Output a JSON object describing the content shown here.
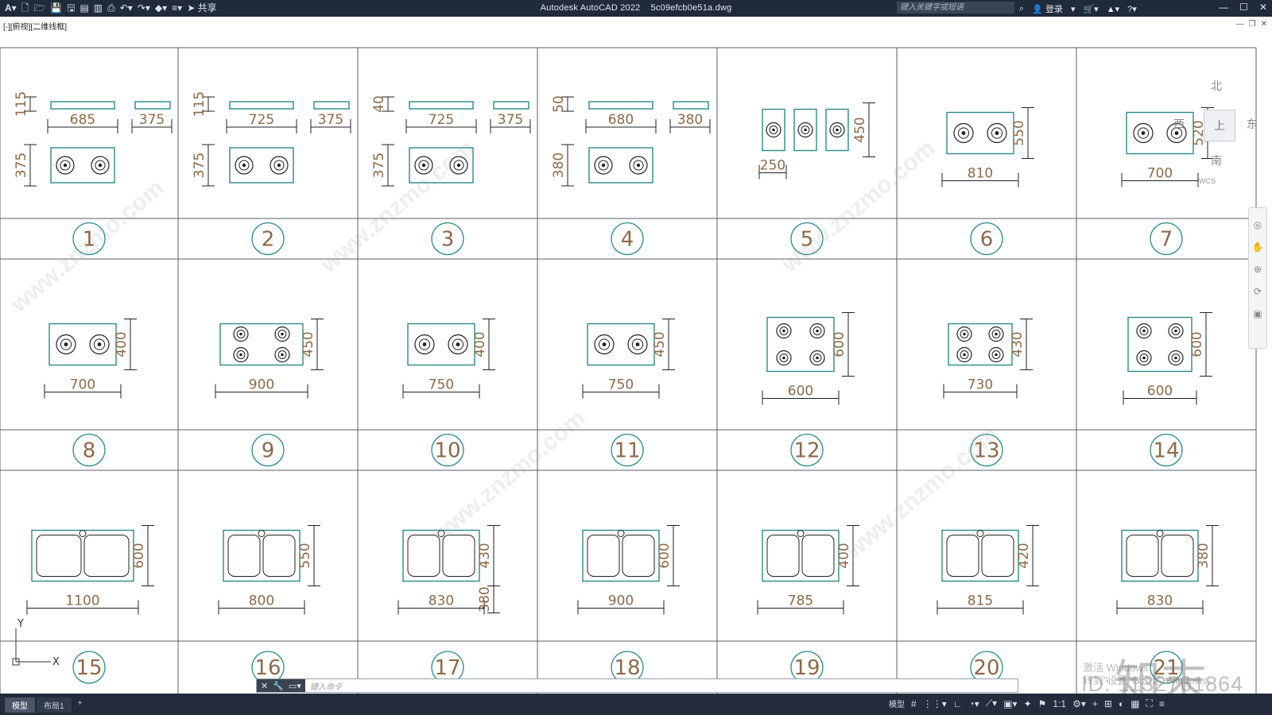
{
  "titlebar": {
    "app_name": "Autodesk AutoCAD 2022",
    "file_name": "5c09efcb0e51a.dwg",
    "share_label": "共享",
    "search_placeholder": "键入关键字或短语",
    "login_label": "登录"
  },
  "viewport_label": "[-][俯视][二维线框]",
  "viewcube": {
    "north": "北",
    "south": "南",
    "east": "东",
    "west": "西",
    "face": "上",
    "wcs": "WCS"
  },
  "items": [
    {
      "number": "1",
      "dims": [
        "115",
        "685",
        "375",
        "375"
      ]
    },
    {
      "number": "2",
      "dims": [
        "115",
        "725",
        "375",
        "375"
      ]
    },
    {
      "number": "3",
      "dims": [
        "40",
        "725",
        "375",
        "375"
      ]
    },
    {
      "number": "4",
      "dims": [
        "50",
        "680",
        "380",
        "380"
      ]
    },
    {
      "number": "5",
      "dims": [
        "450",
        "250"
      ]
    },
    {
      "number": "6",
      "dims": [
        "550",
        "810"
      ]
    },
    {
      "number": "7",
      "dims": [
        "520",
        "700"
      ]
    },
    {
      "number": "8",
      "dims": [
        "400",
        "700"
      ]
    },
    {
      "number": "9",
      "dims": [
        "450",
        "900"
      ]
    },
    {
      "number": "10",
      "dims": [
        "400",
        "750"
      ]
    },
    {
      "number": "11",
      "dims": [
        "450",
        "750"
      ]
    },
    {
      "number": "12",
      "dims": [
        "600",
        "600"
      ]
    },
    {
      "number": "13",
      "dims": [
        "430",
        "730"
      ]
    },
    {
      "number": "14",
      "dims": [
        "600",
        "600"
      ]
    },
    {
      "number": "15",
      "dims": [
        "600",
        "1100"
      ]
    },
    {
      "number": "16",
      "dims": [
        "550",
        "800"
      ]
    },
    {
      "number": "17",
      "dims": [
        "430",
        "380",
        "830"
      ]
    },
    {
      "number": "18",
      "dims": [
        "600",
        "900"
      ]
    },
    {
      "number": "19",
      "dims": [
        "400",
        "785"
      ]
    },
    {
      "number": "20",
      "dims": [
        "420",
        "815"
      ]
    },
    {
      "number": "21",
      "dims": [
        "380",
        "830"
      ]
    }
  ],
  "ucs": {
    "x_label": "X",
    "y_label": "Y"
  },
  "commandline": {
    "placeholder": "键入命令"
  },
  "statusbar": {
    "tab_model": "模型",
    "tab_layout1": "布局1",
    "model_label": "模型",
    "scale_label": "1:1"
  },
  "watermark": {
    "text": "www.znzmo.com",
    "brand": "知末",
    "id_text": "ID: 1132761864",
    "activate_line1": "激活 Windows",
    "activate_line2": "转到\"设置\"以激活 Windows。"
  },
  "colors": {
    "grid_line": "#5a5f66",
    "drawing_outline": "#2b8a8a",
    "label_brown": "#8d6a4a",
    "titlebar_bg": "#1f2a3a",
    "statusbar_bg": "#222c3a"
  }
}
